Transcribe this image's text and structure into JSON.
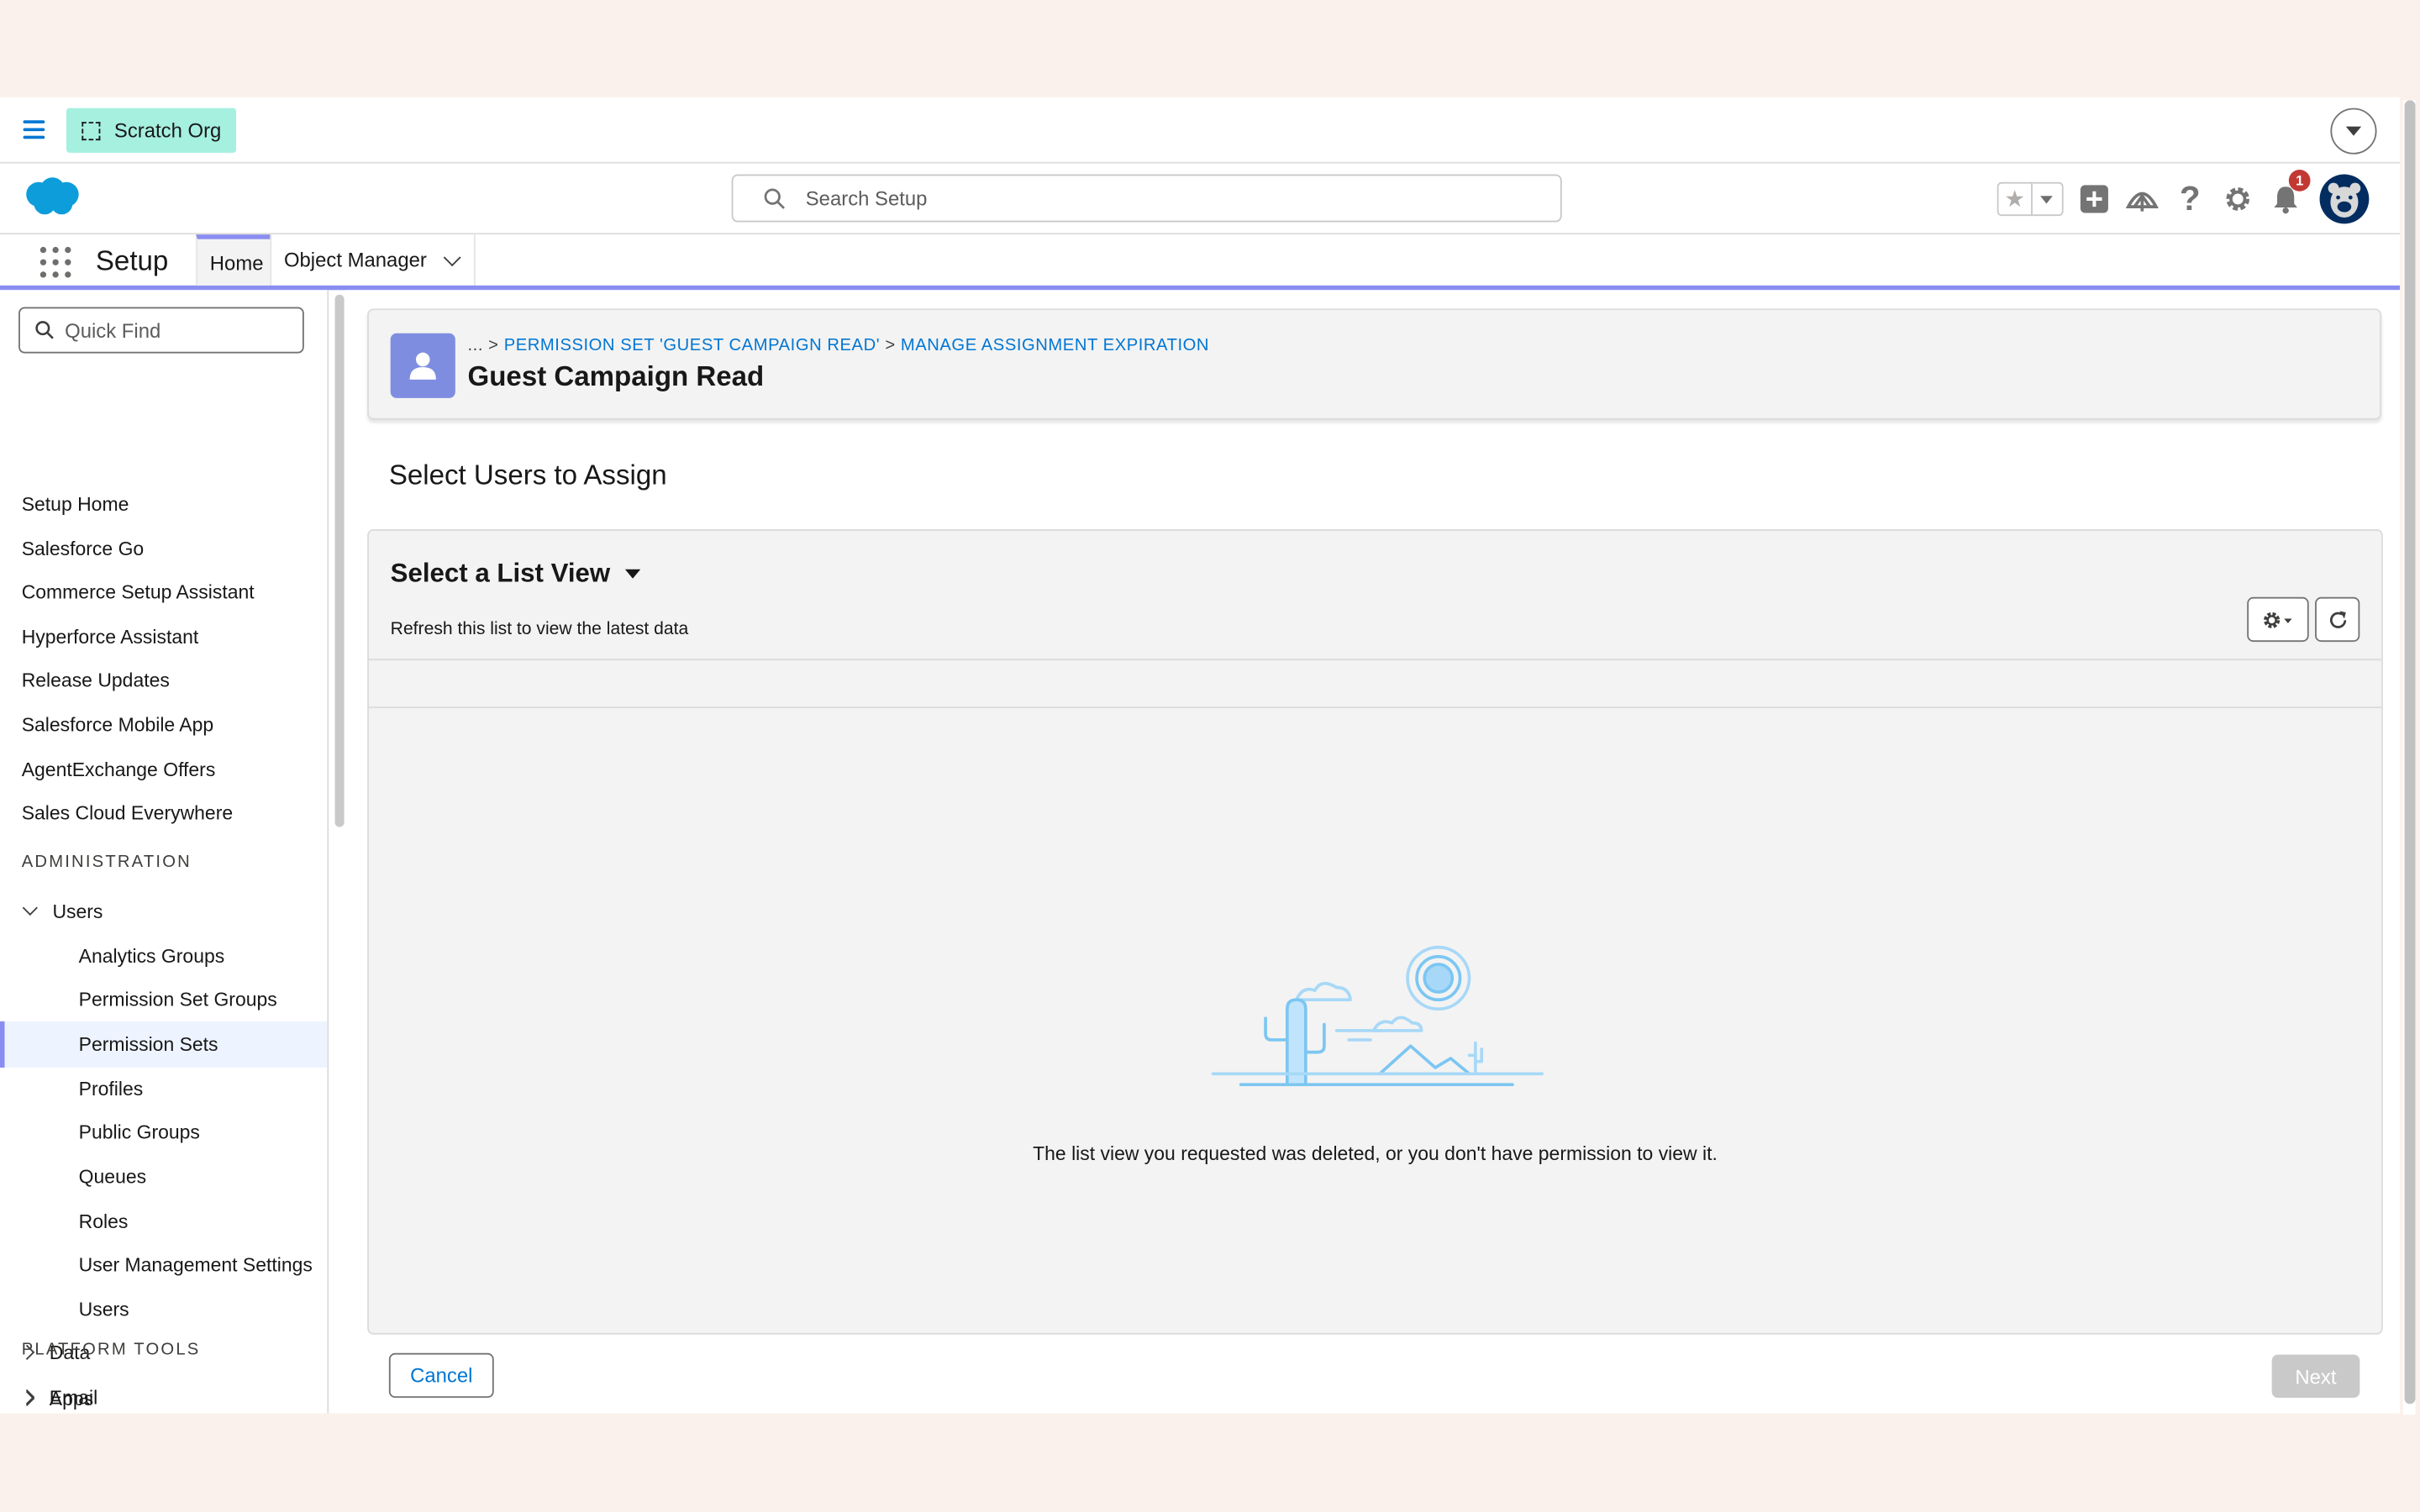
{
  "org": {
    "name": "Scratch Org"
  },
  "search": {
    "placeholder": "Search Setup"
  },
  "notifications": {
    "count": "1"
  },
  "nav": {
    "app_title": "Setup",
    "tabs": [
      {
        "label": "Home"
      },
      {
        "label": "Object Manager"
      }
    ]
  },
  "sidebar": {
    "quick_find_placeholder": "Quick Find",
    "items": [
      "Setup Home",
      "Salesforce Go",
      "Commerce Setup Assistant",
      "Hyperforce Assistant",
      "Release Updates",
      "Salesforce Mobile App",
      "AgentExchange Offers",
      "Sales Cloud Everywhere"
    ],
    "section_admin": "ADMINISTRATION",
    "users_group": "Users",
    "users_children": [
      "Analytics Groups",
      "Permission Set Groups",
      "Permission Sets",
      "Profiles",
      "Public Groups",
      "Queues",
      "Roles",
      "User Management Settings",
      "Users"
    ],
    "data_group": "Data",
    "email_group": "Email",
    "section_platform": "PLATFORM TOOLS",
    "apps_group": "Apps"
  },
  "page_header": {
    "crumb_ellipsis": "... >",
    "crumb1": "PERMISSION SET 'GUEST CAMPAIGN READ'",
    "crumb_sep": ">",
    "crumb2": "MANAGE ASSIGNMENT EXPIRATION",
    "title": "Guest Campaign Read"
  },
  "section_title": "Select Users to Assign",
  "list_view": {
    "title": "Select a List View",
    "subtitle": "Refresh this list to view the latest data",
    "empty_message": "The list view you requested was deleted, or you don't have permission to view it."
  },
  "footer": {
    "cancel_label": "Cancel",
    "next_label": "Next"
  },
  "colors": {
    "brand_blue": "#0176d3",
    "accent_purple": "#8a8ef0",
    "org_chip": "#a6f0e0",
    "badge_red": "#c23934"
  }
}
